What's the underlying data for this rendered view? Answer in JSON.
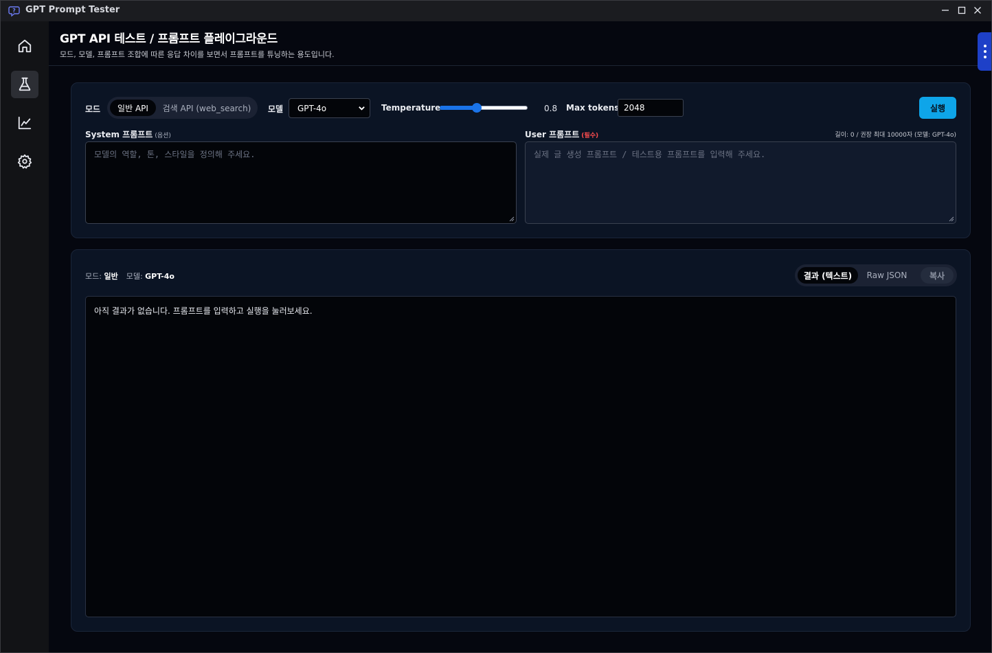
{
  "window": {
    "title": "GPT Prompt Tester"
  },
  "header": {
    "title": "GPT API 테스트 / 프롬프트 플레이그라운드",
    "subtitle": "모드, 모델, 프롬프트 조합에 따른 응답 차이를 보면서 프롬프트를 튜닝하는 용도입니다."
  },
  "sidebar": {
    "items": [
      {
        "icon": "home-icon",
        "active": false
      },
      {
        "icon": "flask-icon",
        "active": true
      },
      {
        "icon": "chart-icon",
        "active": false
      },
      {
        "icon": "gear-icon",
        "active": false
      }
    ]
  },
  "controls": {
    "mode_label": "모드",
    "mode_options": [
      "일반 API",
      "검색 API (web_search)"
    ],
    "mode_selected": "일반 API",
    "model_label": "모델",
    "model_value": "GPT-4o",
    "temperature_label": "Temperature",
    "temperature_value": "0.8",
    "temperature_fraction": 0.4,
    "max_tokens_label": "Max tokens",
    "max_tokens_value": "2048",
    "run_label": "실행"
  },
  "prompts": {
    "system_label": "System 프롬프트",
    "system_tag": "(옵션)",
    "system_placeholder": "모델의 역할, 톤, 스타일을 정의해 주세요.",
    "user_label": "User 프롬프트",
    "user_tag": "(필수)",
    "length_info": "길이: 0 / 권장 최대 10000자 (모델: GPT-4o)",
    "user_placeholder": "실제 글 생성 프롬프트 / 테스트용 프롬프트를 입력해 주세요."
  },
  "result": {
    "mode_prefix": "모드:",
    "mode_value": "일반",
    "model_prefix": "모델:",
    "model_value": "GPT-4o",
    "tab_text": "결과 (텍스트)",
    "tab_raw": "Raw JSON",
    "copy_label": "복사",
    "empty_message": "아직 결과가 없습니다. 프롬프트를 입력하고 실행을 눌러보세요."
  },
  "colors": {
    "accent": "#0ea5e9",
    "slider": "#1a73e8",
    "required": "#ff4d4f",
    "handle": "#1e40c8"
  }
}
